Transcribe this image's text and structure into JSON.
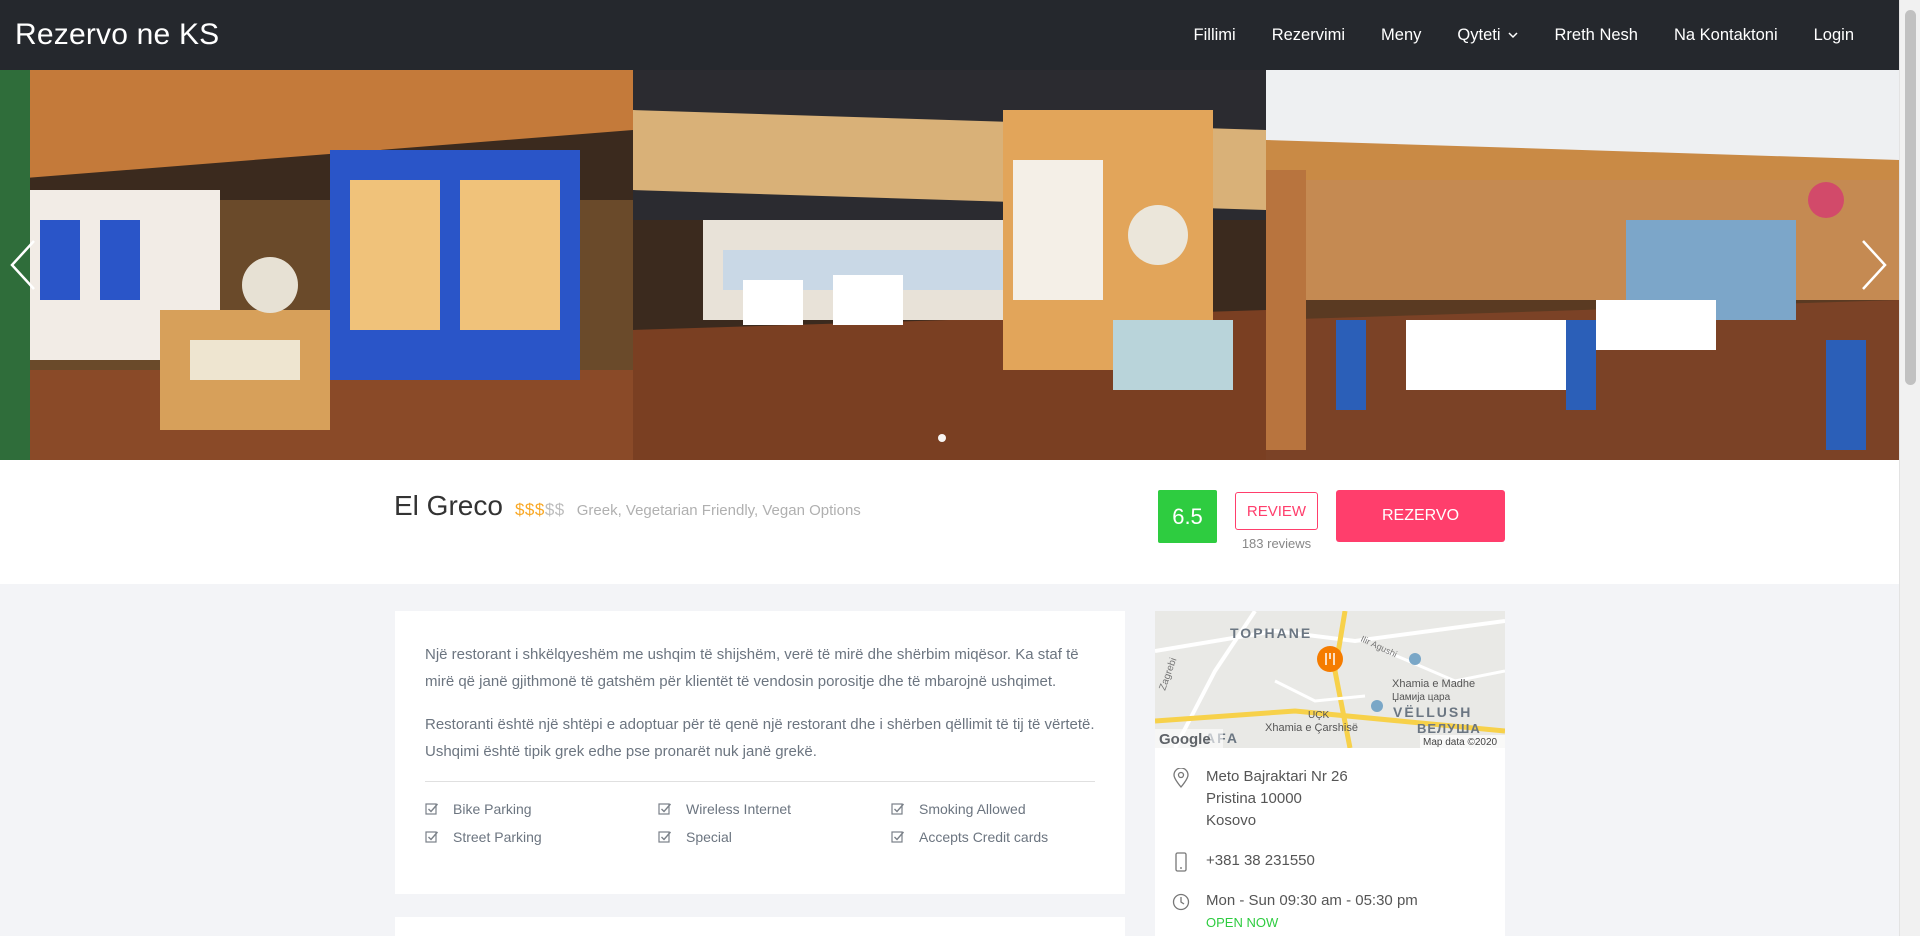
{
  "nav": {
    "brand": "Rezervo ne KS",
    "items": [
      "Fillimi",
      "Rezervimi",
      "Meny",
      "Qyteti",
      "Rreth Nesh",
      "Na Kontaktoni",
      "Login"
    ]
  },
  "restaurant": {
    "name": "El Greco",
    "price_active": "$$$",
    "price_inactive": "$$",
    "cuisines": "Greek, Vegetarian Friendly, Vegan Options",
    "score": "6.5",
    "review_label": "REVIEW",
    "reviews_count": "183 reviews",
    "reserve_label": "REZERVO"
  },
  "description": {
    "p1": "Një restorant i shkëlqyeshëm me ushqim të shijshëm, verë të mirë dhe shërbim miqësor. Ka staf të mirë që janë gjithmonë të gatshëm për klientët të vendosin porositje dhe të mbarojnë ushqimet.",
    "p2": "Restoranti është një shtëpi e adoptuar për të qenë një restorant dhe i shërben qëllimit të tij të vërtetë. Ushqimi është tipik grek edhe pse pronarët nuk janë grekë."
  },
  "amenities": [
    "Bike Parking",
    "Wireless Internet",
    "Smoking Allowed",
    "Street Parking",
    "Special",
    "Accepts Credit cards"
  ],
  "map": {
    "labels": [
      "TOPHANE",
      "Xhamia e Madhe",
      "Џамија царa",
      "VËLLUSH",
      "ВЕЛУША",
      "Xhamia e Çarshisë",
      "UÇK",
      "Zagrebi",
      "Ilir Agushi",
      "AFA",
      "Google",
      "Map data ©2020"
    ]
  },
  "contact": {
    "address_line1": "Meto Bajraktari Nr 26",
    "address_line2": "Pristina 10000",
    "address_line3": "Kosovo",
    "phone": "+381 38 231550",
    "hours": "Mon - Sun 09:30 am - 05:30 pm",
    "status": "OPEN NOW"
  },
  "colors": {
    "accent": "#ff3e6c",
    "score_bg": "#2ecc40",
    "navbar_bg": "#25282d",
    "price_active": "#f9a825"
  }
}
